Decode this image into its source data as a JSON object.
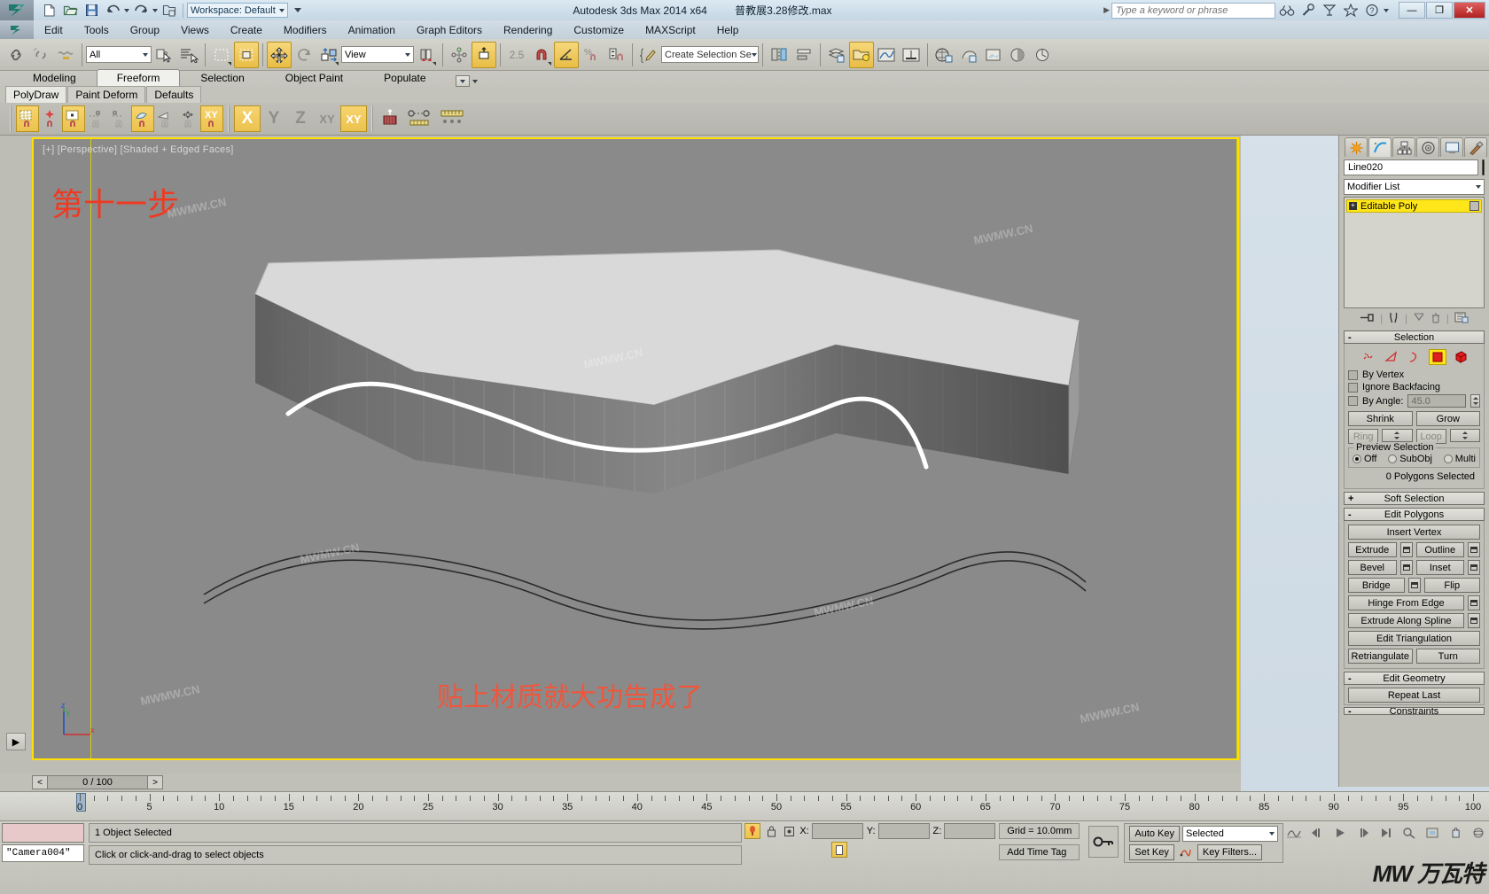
{
  "titlebar": {
    "workspace": "Workspace: Default",
    "app_title": "Autodesk 3ds Max  2014 x64",
    "file_name": "普教展3.28修改.max",
    "search_placeholder": "Type a keyword or phrase",
    "quick_access": [
      "new-icon",
      "open-icon",
      "save-icon",
      "undo-icon",
      "redo-icon",
      "set-project-icon"
    ],
    "right_icons": [
      "binoculars-icon",
      "wrench-icon",
      "subscription-icon",
      "favorites-star-icon",
      "help-icon"
    ],
    "window_buttons": {
      "minimize": "—",
      "restore": "❐",
      "close": "✕"
    }
  },
  "menubar": {
    "items": [
      "Edit",
      "Tools",
      "Group",
      "Views",
      "Create",
      "Modifiers",
      "Animation",
      "Graph Editors",
      "Rendering",
      "Customize",
      "MAXScript",
      "Help"
    ]
  },
  "toolbar": {
    "selection_filter": "All",
    "reference_coord": "View",
    "named_selection_set": "Create Selection Se",
    "snap_percent": "2.5"
  },
  "ribbon": {
    "tabs": [
      "Modeling",
      "Freeform",
      "Selection",
      "Object Paint",
      "Populate"
    ],
    "active_tab": "Freeform",
    "subtabs": [
      "PolyDraw",
      "Paint Deform",
      "Defaults"
    ],
    "active_subtab": "PolyDraw",
    "axis_constraints": [
      "X",
      "Y",
      "Z",
      "XY",
      "XY"
    ]
  },
  "viewport": {
    "label": "[+] [Perspective] [Shaded + Edged Faces]",
    "annotation_top": "第十一步",
    "annotation_bottom": "贴上材质就大功告成了",
    "axis_labels": {
      "z": "z",
      "y": "y",
      "x": "x"
    },
    "watermark": "MWMW.CN"
  },
  "command_panel": {
    "tabs": [
      "create-tab",
      "modify-tab",
      "hierarchy-tab",
      "motion-tab",
      "display-tab",
      "utilities-tab"
    ],
    "active_tab": "modify-tab",
    "object_name": "Line020",
    "modifier_list_label": "Modifier List",
    "modifier_stack": [
      {
        "name": "Editable Poly"
      }
    ],
    "rollups": {
      "selection": {
        "title": "Selection",
        "state": "-",
        "sub_object_modes": [
          "vertex",
          "edge",
          "border",
          "polygon",
          "element"
        ],
        "active_sub_object": "polygon",
        "by_vertex": "By Vertex",
        "ignore_backfacing": "Ignore Backfacing",
        "by_angle": "By Angle:",
        "by_angle_value": "45.0",
        "shrink": "Shrink",
        "grow": "Grow",
        "ring": "Ring",
        "loop": "Loop",
        "preview_selection": "Preview Selection",
        "preview_options": [
          "Off",
          "SubObj",
          "Multi"
        ],
        "preview_active": "Off",
        "status": "0 Polygons Selected"
      },
      "soft_selection": {
        "title": "Soft Selection",
        "state": "+"
      },
      "edit_polygons": {
        "title": "Edit Polygons",
        "state": "-",
        "insert_vertex": "Insert Vertex",
        "extrude": "Extrude",
        "outline": "Outline",
        "bevel": "Bevel",
        "inset": "Inset",
        "bridge": "Bridge",
        "flip": "Flip",
        "hinge_from_edge": "Hinge From Edge",
        "extrude_along_spline": "Extrude Along Spline",
        "edit_triangulation": "Edit Triangulation",
        "retriangulate": "Retriangulate",
        "turn": "Turn"
      },
      "edit_geometry": {
        "title": "Edit Geometry",
        "state": "-",
        "repeat_last": "Repeat Last"
      },
      "constraints": {
        "title": "Constraints"
      }
    }
  },
  "trackbar": {
    "current_frame": "0 / 100",
    "prev": "<",
    "next": ">"
  },
  "timeline": {
    "ticks": [
      "0",
      "5",
      "10",
      "15",
      "20",
      "25",
      "30",
      "35",
      "40",
      "45",
      "50",
      "55",
      "60",
      "65",
      "70",
      "75",
      "80",
      "85",
      "90",
      "95",
      "100"
    ],
    "range_start": 0,
    "range_end": 100
  },
  "statusbar": {
    "mini_listener_value": "\"Camera004\"",
    "selection_status": "1 Object Selected",
    "prompt": "Click or click-and-drag to select objects",
    "x_label": "X:",
    "y_label": "Y:",
    "z_label": "Z:",
    "x_value": "",
    "y_value": "",
    "z_value": "",
    "grid": "Grid = 10.0mm",
    "add_time_tag": "Add Time Tag",
    "auto_key": "Auto Key",
    "set_key": "Set Key",
    "key_filters": "Key Filters...",
    "key_mode": "Selected",
    "brand": "MW 万瓦特"
  },
  "colors": {
    "accent_yellow": "#ffe000",
    "annotation_red": "#ef3a21",
    "viewport_bg": "#8a8a8a",
    "panel_bg": "#c0c0b8",
    "highlight_gold": "#ecc24e"
  }
}
